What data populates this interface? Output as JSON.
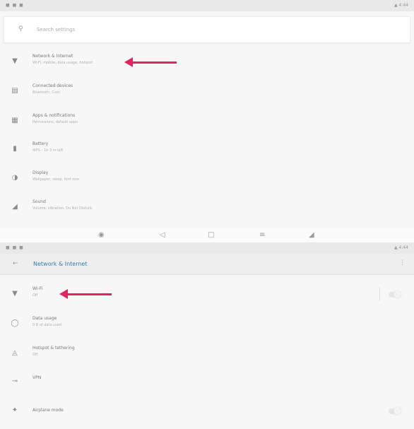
{
  "panel1": {
    "status": {
      "left": "■ ■ ■",
      "right": "▲ 4:44"
    },
    "search": {
      "placeholder": "Search settings"
    },
    "items": [
      {
        "title": "Network & Internet",
        "subtitle": "Wi-Fi, mobile, data usage, hotspot",
        "icon": "wifi-icon"
      },
      {
        "title": "Connected devices",
        "subtitle": "Bluetooth, Cast",
        "icon": "devices-icon"
      },
      {
        "title": "Apps & notifications",
        "subtitle": "Permissions, default apps",
        "icon": "apps-icon"
      },
      {
        "title": "Battery",
        "subtitle": "40% - 1h 3 m left",
        "icon": "battery-icon"
      },
      {
        "title": "Display",
        "subtitle": "Wallpaper, sleep, font size",
        "icon": "display-icon"
      },
      {
        "title": "Sound",
        "subtitle": "Volume, vibration, Do Not Disturb",
        "icon": "sound-icon"
      }
    ],
    "nav": [
      "camera",
      "back",
      "home",
      "recents",
      "volume"
    ]
  },
  "panel2": {
    "status": {
      "left": "■ ■ ■",
      "right": "▲ 4:44"
    },
    "header": {
      "title": "Network & Internet"
    },
    "items": [
      {
        "title": "Wi-Fi",
        "subtitle": "Off",
        "icon": "wifi-icon"
      },
      {
        "title": "Data usage",
        "subtitle": "0 B of data used",
        "icon": "data-usage-icon"
      },
      {
        "title": "Hotspot & tethering",
        "subtitle": "Off",
        "icon": "hotspot-icon"
      },
      {
        "title": "VPN",
        "subtitle": "",
        "icon": "vpn-icon"
      },
      {
        "title": "Airplane mode",
        "subtitle": "",
        "icon": "airplane-icon"
      }
    ]
  },
  "colors": {
    "accent": "#2b7fb6",
    "arrow": "#e0245e"
  }
}
